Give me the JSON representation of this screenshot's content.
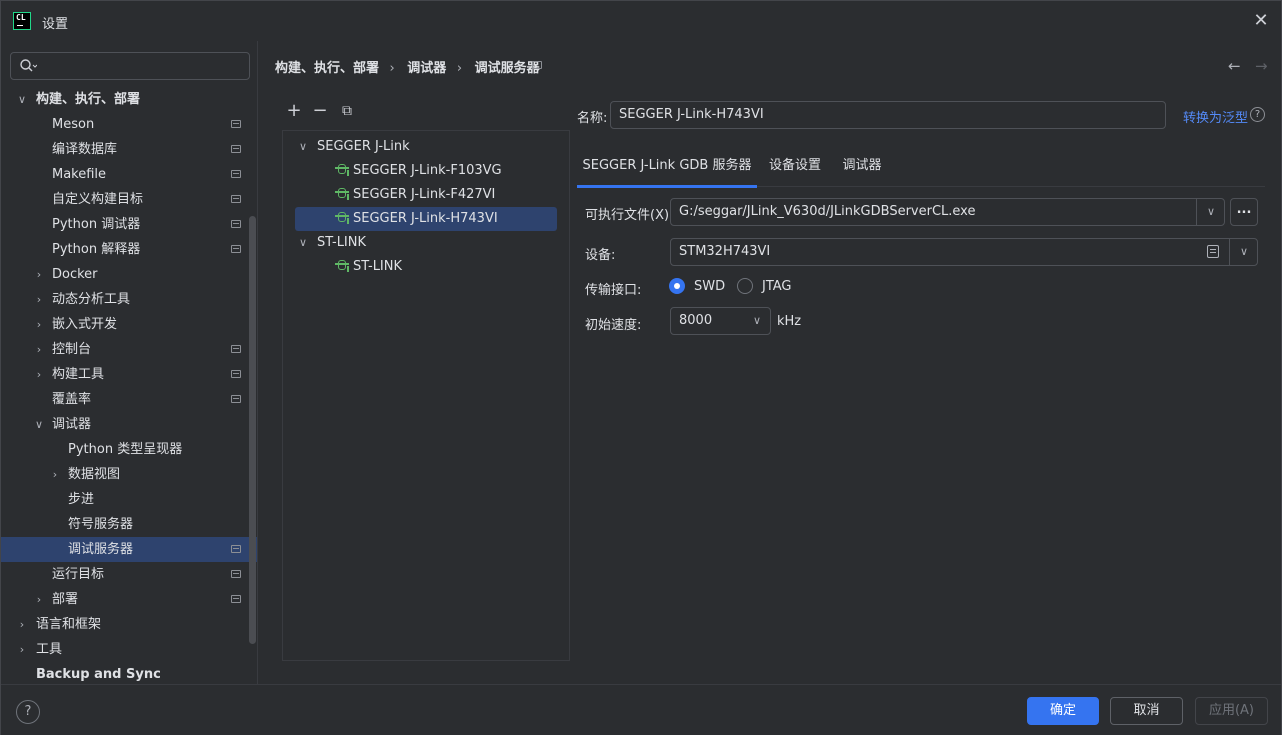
{
  "window": {
    "title": "设置",
    "logo_text": "CL"
  },
  "search": {
    "placeholder": ""
  },
  "sidebar": {
    "items": [
      {
        "label": "构建、执行、部署",
        "bold": true,
        "level": 0,
        "expanded": true,
        "selected": false,
        "project": false
      },
      {
        "label": "Meson",
        "level": 1,
        "project": true
      },
      {
        "label": "编译数据库",
        "level": 1,
        "project": true
      },
      {
        "label": "Makefile",
        "level": 1,
        "project": true
      },
      {
        "label": "自定义构建目标",
        "level": 1,
        "project": true
      },
      {
        "label": "Python 调试器",
        "level": 1,
        "project": true
      },
      {
        "label": "Python 解释器",
        "level": 1,
        "project": true
      },
      {
        "label": "Docker",
        "level": 1,
        "collapsed": true
      },
      {
        "label": "动态分析工具",
        "level": 1,
        "collapsed": true
      },
      {
        "label": "嵌入式开发",
        "level": 1,
        "collapsed": true
      },
      {
        "label": "控制台",
        "level": 1,
        "collapsed": true,
        "project": true
      },
      {
        "label": "构建工具",
        "level": 1,
        "collapsed": true,
        "project": true
      },
      {
        "label": "覆盖率",
        "level": 1,
        "project": true
      },
      {
        "label": "调试器",
        "level": 1,
        "expanded": true
      },
      {
        "label": "Python 类型呈现器",
        "level": 2
      },
      {
        "label": "数据视图",
        "level": 2,
        "collapsed": true
      },
      {
        "label": "步进",
        "level": 2
      },
      {
        "label": "符号服务器",
        "level": 2
      },
      {
        "label": "调试服务器",
        "level": 2,
        "selected": true,
        "project": true
      },
      {
        "label": "运行目标",
        "level": 1,
        "project": true
      },
      {
        "label": "部署",
        "level": 1,
        "collapsed": true,
        "project": true
      },
      {
        "label": "语言和框架",
        "level": 0,
        "collapsed": true
      },
      {
        "label": "工具",
        "level": 0,
        "collapsed": true
      },
      {
        "label": "Backup and Sync",
        "level": 0,
        "bold": true
      }
    ]
  },
  "breadcrumb": {
    "part1": "构建、执行、部署",
    "part2": "调试器",
    "part3": "调试服务器",
    "sep": "›"
  },
  "toolbar": {
    "add": "+",
    "remove": "−",
    "copy": "⧉"
  },
  "config_tree": {
    "groups": [
      {
        "label": "SEGGER J-Link",
        "children": [
          "SEGGER J-Link-F103VG",
          "SEGGER J-Link-F427VI",
          "SEGGER J-Link-H743VI"
        ]
      },
      {
        "label": "ST-LINK",
        "children": [
          "ST-LINK"
        ]
      }
    ]
  },
  "form": {
    "name_label": "名称:",
    "name_value": "SEGGER J-Link-H743VI",
    "convert_link": "转换为泛型",
    "tabs": [
      "SEGGER J-Link GDB 服务器",
      "设备设置",
      "调试器"
    ],
    "exe_label": "可执行文件(X):",
    "exe_value": "G:/seggar/JLink_V630d/JLinkGDBServerCL.exe",
    "device_label": "设备:",
    "device_value": "STM32H743VI",
    "interface_label": "传输接口:",
    "interface_options": [
      "SWD",
      "JTAG"
    ],
    "interface_selected": "SWD",
    "speed_label": "初始速度:",
    "speed_value": "8000",
    "speed_unit": "kHz",
    "browse_label": "..."
  },
  "footer": {
    "ok": "确定",
    "cancel": "取消",
    "apply": "应用(A)",
    "help": "?"
  },
  "colors": {
    "accent": "#3574f0",
    "selection": "#2e436e",
    "link": "#548af7",
    "bg": "#2b2d30"
  }
}
